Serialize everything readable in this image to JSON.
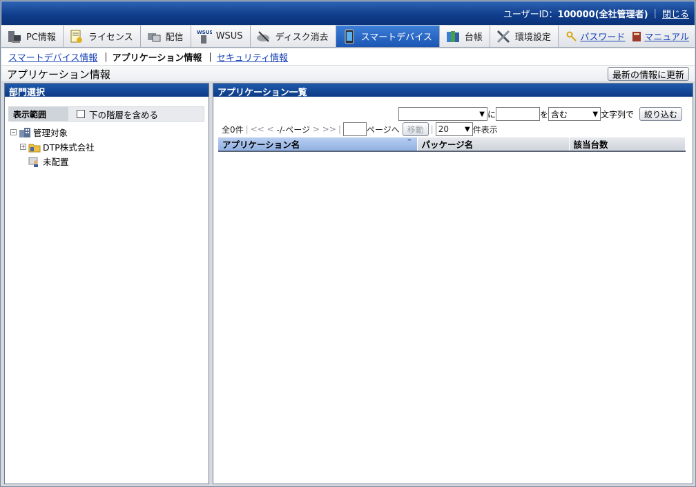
{
  "topbar": {
    "user_label": "ユーザーID：",
    "user_value": "100000(全社管理者)",
    "close": "閉じる"
  },
  "tabs": [
    {
      "label": "PC情報",
      "icon": "pc-icon"
    },
    {
      "label": "ライセンス",
      "icon": "license-icon"
    },
    {
      "label": "配信",
      "icon": "delivery-icon"
    },
    {
      "label": "WSUS",
      "icon": "wsus-icon"
    },
    {
      "label": "ディスク消去",
      "icon": "disk-erase-icon"
    },
    {
      "label": "スマートデバイス",
      "icon": "smart-device-icon"
    },
    {
      "label": "台帳",
      "icon": "ledger-icon"
    },
    {
      "label": "環境設定",
      "icon": "settings-icon"
    }
  ],
  "links": {
    "password": "パスワード",
    "manual": "マニュアル"
  },
  "subnav": {
    "smart_device_info": "スマートデバイス情報",
    "app_info": "アプリケーション情報",
    "security_info": "セキュリティ情報"
  },
  "page": {
    "title": "アプリケーション情報",
    "refresh": "最新の情報に更新"
  },
  "left_panel": {
    "header": "部門選択",
    "scope_label": "表示範囲",
    "include_sub": "下の階層を含める",
    "tree": {
      "root": "管理対象",
      "company": "DTP株式会社",
      "unassigned": "未配置"
    }
  },
  "right_panel": {
    "header": "アプリケーション一覧",
    "filter": {
      "ni": "に",
      "wo": "を",
      "match": "含む",
      "suffix": "文字列で",
      "button": "絞り込む"
    },
    "pager": {
      "total": "全0件",
      "first": "<<",
      "prev": "<",
      "pages": "-/-ページ",
      "next": ">",
      "last": ">>",
      "goto_suffix": "ページへ",
      "move": "移動",
      "per_page": "20",
      "per_page_suffix": "件表示"
    },
    "columns": [
      "アプリケーション名",
      "パッケージ名",
      "該当台数"
    ]
  }
}
